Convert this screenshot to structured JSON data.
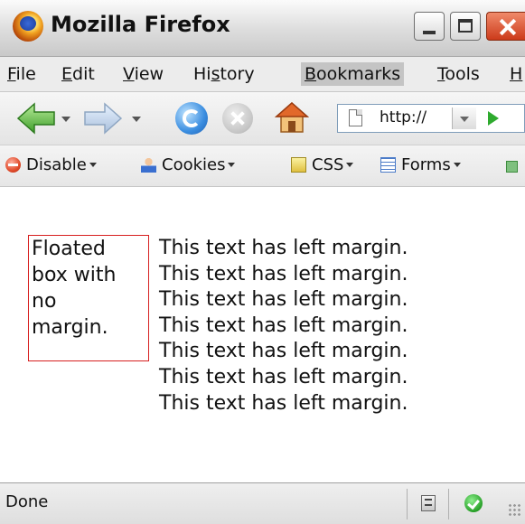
{
  "window": {
    "title": "Mozilla Firefox",
    "buttons": [
      "minimize",
      "maximize",
      "close"
    ]
  },
  "menubar": {
    "items": [
      {
        "label": "File",
        "mnemonic": "F"
      },
      {
        "label": "Edit",
        "mnemonic": "E"
      },
      {
        "label": "View",
        "mnemonic": "V"
      },
      {
        "label": "History",
        "mnemonic": "s"
      },
      {
        "label": "Bookmarks",
        "mnemonic": "B"
      },
      {
        "label": "Tools",
        "mnemonic": "T"
      },
      {
        "label": "Help",
        "mnemonic": "H"
      }
    ],
    "active_item": "Bookmarks"
  },
  "navbar": {
    "url": "http://",
    "icons": [
      "back-icon",
      "forward-icon",
      "reload-icon",
      "stop-icon",
      "home-icon",
      "page-icon",
      "go-icon"
    ]
  },
  "devbar": {
    "items": [
      {
        "label": "Disable",
        "icon": "disable-icon"
      },
      {
        "label": "Cookies",
        "icon": "cookies-icon"
      },
      {
        "label": "CSS",
        "icon": "css-icon"
      },
      {
        "label": "Forms",
        "icon": "forms-icon"
      }
    ]
  },
  "content": {
    "float_box_lines": [
      "Floated",
      "box with",
      "no",
      "margin."
    ],
    "margin_text_lines": [
      "This text has left margin.",
      "This text has left margin.",
      "This text has left margin.",
      "This text has left margin.",
      "This text has left margin.",
      "This text has left margin.",
      "This text has left margin."
    ]
  },
  "statusbar": {
    "text": "Done",
    "icons": [
      "clipboard-icon",
      "security-ok-icon"
    ]
  },
  "colors": {
    "float_border": "#d72020",
    "menu_active_bg": "#c4c4c4"
  }
}
